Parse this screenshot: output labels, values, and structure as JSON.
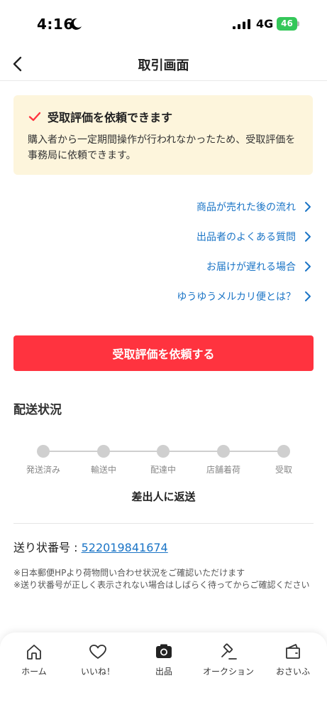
{
  "status_bar": {
    "time": "4:16",
    "network": "4G",
    "battery": "46"
  },
  "nav": {
    "title": "取引画面"
  },
  "notice": {
    "title": "受取評価を依頼できます",
    "body": "購入者から一定期間操作が行われなかったため、受取評価を事務局に依頼できます。"
  },
  "links": [
    {
      "label": "商品が売れた後の流れ"
    },
    {
      "label": "出品者のよくある質問"
    },
    {
      "label": "お届けが遅れる場合"
    },
    {
      "label": "ゆうゆうメルカリ便とは？"
    }
  ],
  "primary_button": {
    "label": "受取評価を依頼する"
  },
  "shipping": {
    "title": "配送状況",
    "steps": [
      {
        "label": "発送済み"
      },
      {
        "label": "輸送中"
      },
      {
        "label": "配達中"
      },
      {
        "label": "店舗着荷"
      },
      {
        "label": "受取"
      }
    ],
    "status": "差出人に返送"
  },
  "tracking": {
    "label": "送り状番号 : ",
    "number": "522019841674"
  },
  "notes": [
    "※日本郵便HPより荷物問い合わせ状況をご確認いただけます",
    "※送り状番号が正しく表示されない場合はしばらく待ってからご確認ください"
  ],
  "tabbar": {
    "items": [
      {
        "label": "ホーム",
        "icon": "home-icon"
      },
      {
        "label": "いいね！",
        "icon": "heart-icon"
      },
      {
        "label": "出品",
        "icon": "camera-icon"
      },
      {
        "label": "オークション",
        "icon": "gavel-icon"
      },
      {
        "label": "おさいふ",
        "icon": "wallet-icon"
      }
    ]
  },
  "colors": {
    "accent_red": "#ff333f",
    "link_blue": "#1a74c6",
    "notice_bg": "#fdf5dc",
    "battery_green": "#34c759"
  }
}
